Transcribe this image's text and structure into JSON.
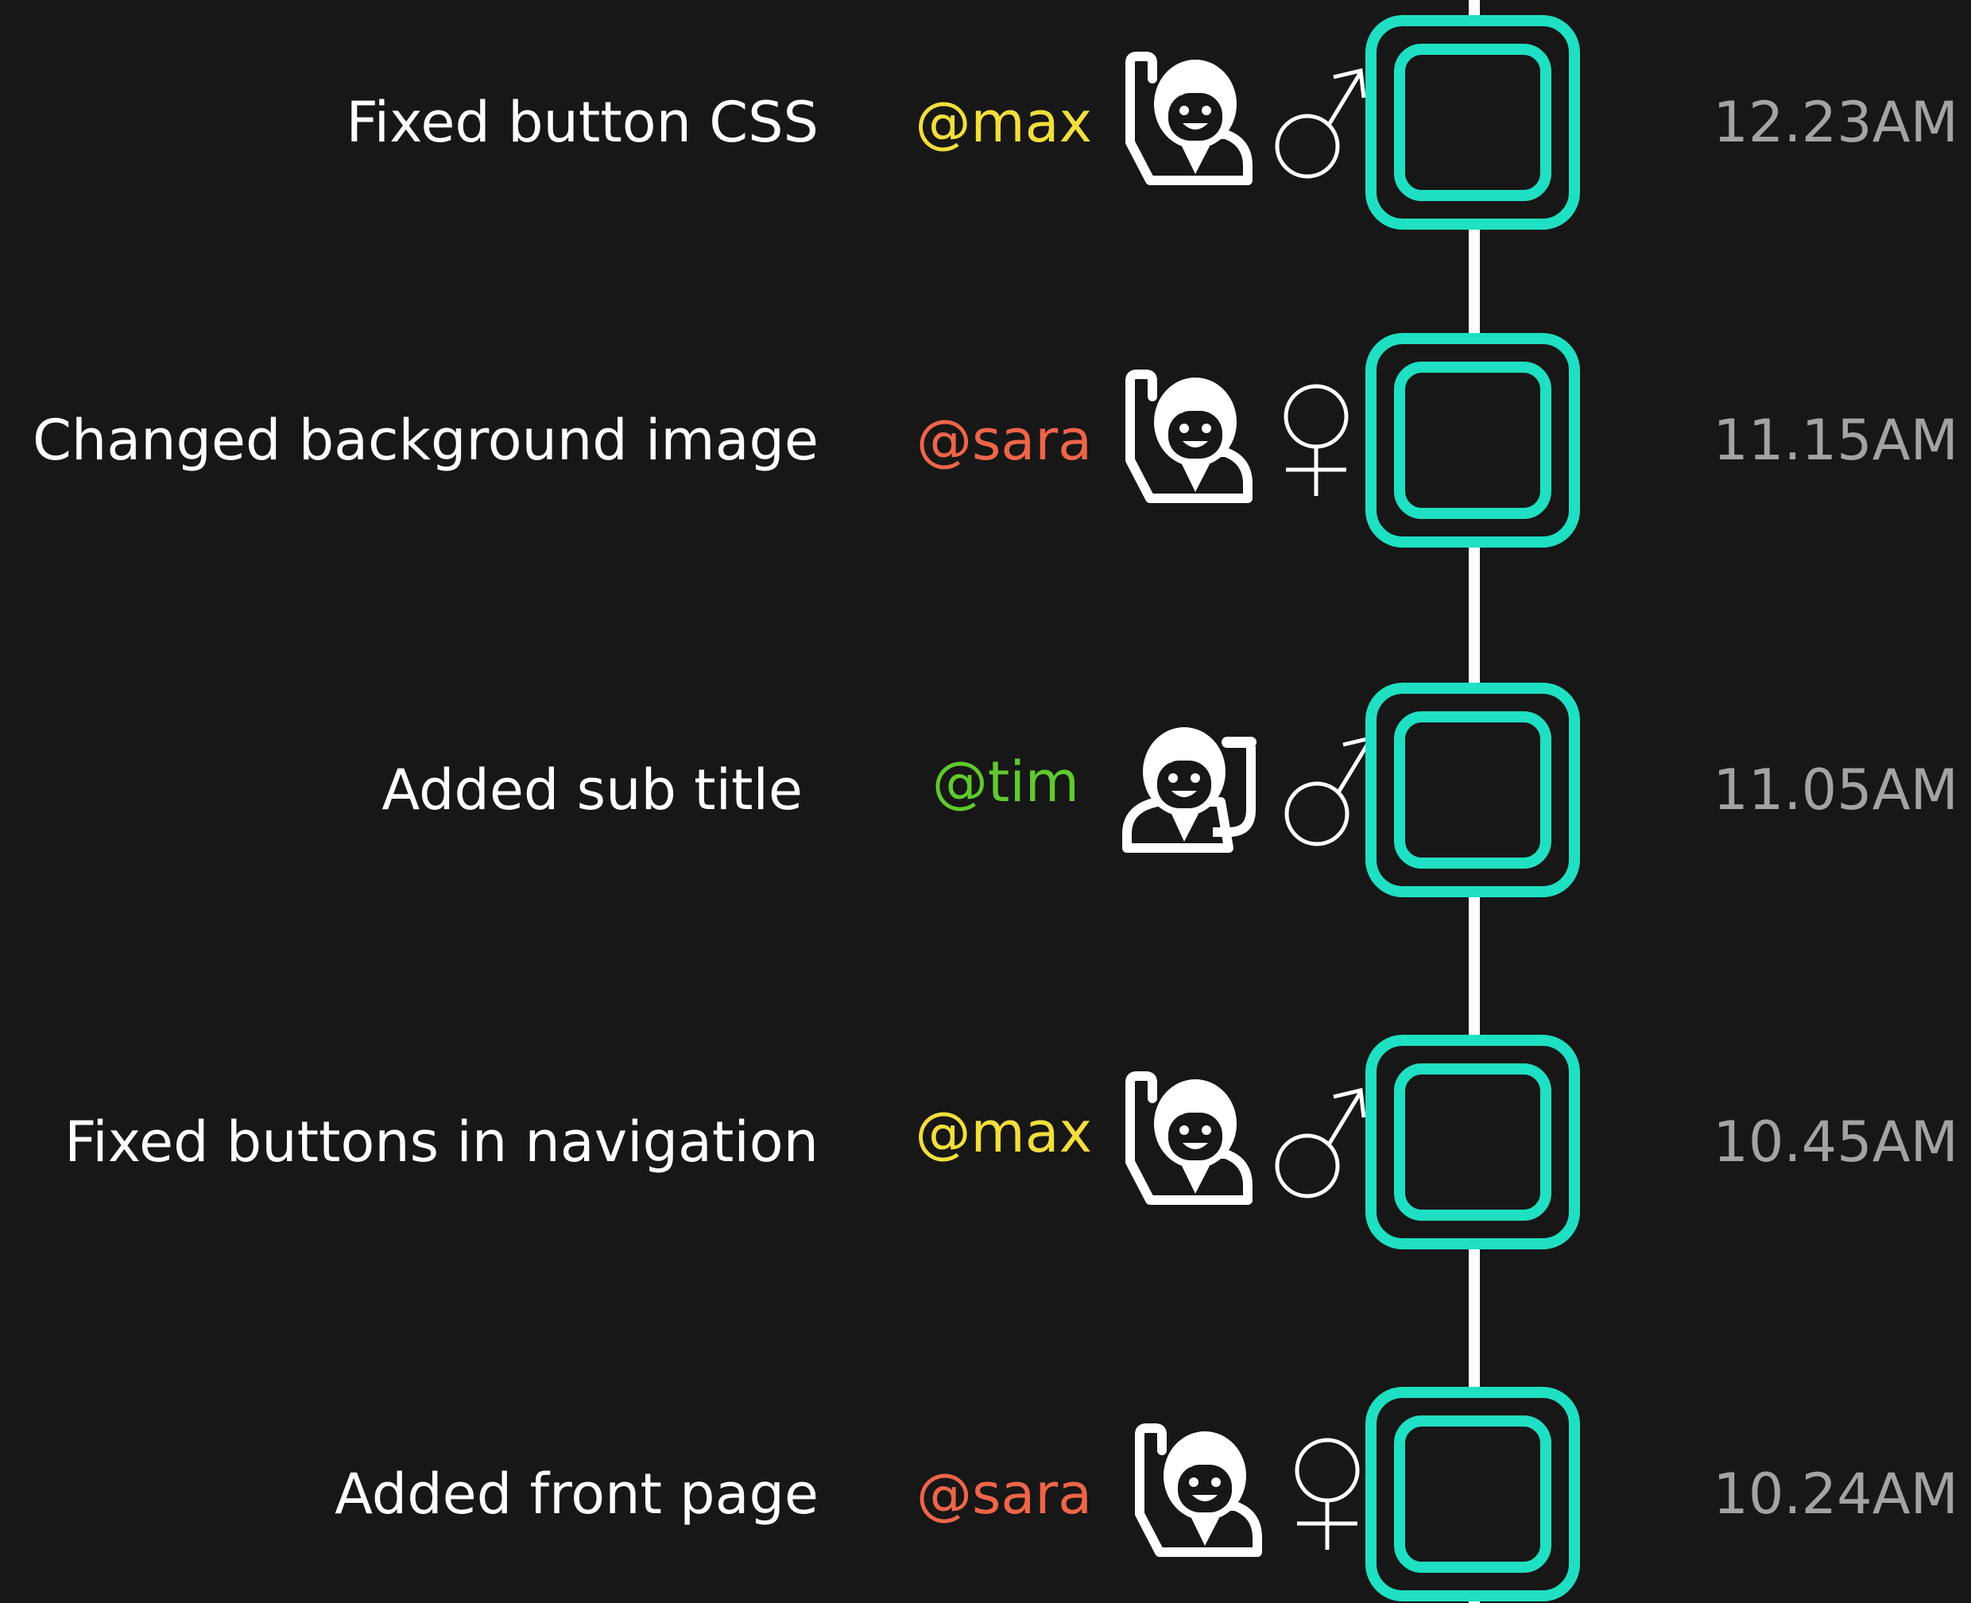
{
  "colors": {
    "background": "#171717",
    "node": "#1fe0c2",
    "spine": "#ffffff",
    "max": "#f2de3c",
    "sara": "#ef6548",
    "tim": "#5fca2c",
    "time": "#a3a3a3"
  },
  "entries": [
    {
      "message": "Fixed button CSS",
      "user": "@max",
      "gender_icon": "male-icon",
      "person_icon": "person-raising-hand-icon",
      "time": "12.23AM"
    },
    {
      "message": "Changed background image",
      "user": "@sara",
      "gender_icon": "female-icon",
      "person_icon": "person-raising-hand-icon",
      "time": "11.15AM"
    },
    {
      "message": "Added sub title",
      "user": "@tim",
      "gender_icon": "male-icon",
      "person_icon": "person-raising-hand-icon",
      "time": "11.05AM"
    },
    {
      "message": "Fixed buttons in navigation",
      "user": "@max",
      "gender_icon": "male-icon",
      "person_icon": "person-raising-hand-icon",
      "time": "10.45AM"
    },
    {
      "message": "Added front page",
      "user": "@sara",
      "gender_icon": "female-icon",
      "person_icon": "person-raising-hand-icon",
      "time": "10.24AM"
    }
  ]
}
